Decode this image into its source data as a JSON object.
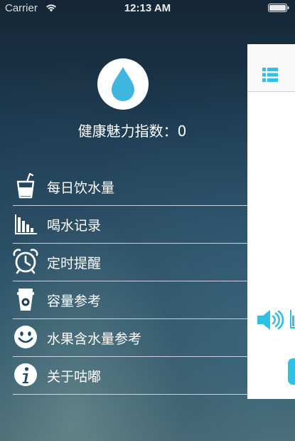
{
  "status_bar": {
    "carrier": "Carrier",
    "time": "12:13 AM"
  },
  "profile": {
    "health_score_label": "健康魅力指数：0"
  },
  "menu": {
    "items": [
      {
        "label": "每日饮水量",
        "icon": "cup-icon"
      },
      {
        "label": "喝水记录",
        "icon": "bar-chart-icon"
      },
      {
        "label": "定时提醒",
        "icon": "alarm-clock-icon"
      },
      {
        "label": "容量参考",
        "icon": "coffee-cup-icon"
      },
      {
        "label": "水果含水量参考",
        "icon": "smiley-icon"
      },
      {
        "label": "关于咕嘟",
        "icon": "info-icon"
      }
    ]
  },
  "colors": {
    "accent": "#2ec0e5",
    "drop": "#3eb6e0",
    "menu_text": "#ffffff"
  }
}
